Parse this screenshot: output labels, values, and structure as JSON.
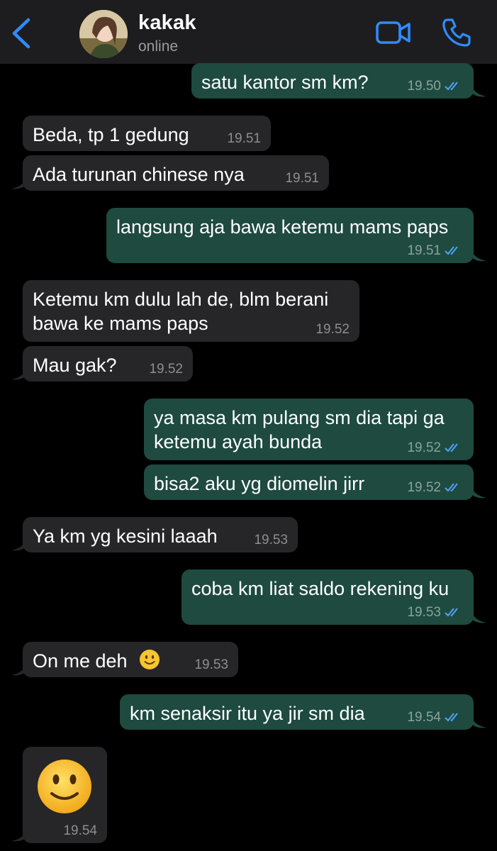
{
  "header": {
    "contact_name": "kakak",
    "status": "online",
    "back_icon": "chevron-left-icon",
    "video_icon": "video-camera-icon",
    "call_icon": "phone-icon",
    "accent": "#2f8cff"
  },
  "messages": [
    {
      "dir": "out",
      "text": "satu kantor sm km?",
      "time": "19.50"
    },
    {
      "dir": "in",
      "text": "Beda, tp 1 gedung",
      "time": "19.51"
    },
    {
      "dir": "in",
      "text": "Ada turunan chinese nya",
      "time": "19.51"
    },
    {
      "dir": "out",
      "text": "langsung aja bawa ketemu mams paps",
      "time": "19.51"
    },
    {
      "dir": "in",
      "text_line1": "Ketemu km dulu lah de, blm berani",
      "text_line2": "bawa ke mams paps",
      "time": "19.52"
    },
    {
      "dir": "in",
      "text": "Mau gak?",
      "time": "19.52"
    },
    {
      "dir": "out",
      "text_line1": "ya masa km pulang sm dia tapi ga",
      "text_line2": "ketemu ayah bunda",
      "time": "19.52"
    },
    {
      "dir": "out",
      "text": "bisa2 aku yg diomelin jirr",
      "time": "19.52"
    },
    {
      "dir": "in",
      "text": "Ya km yg kesini laaah",
      "time": "19.53"
    },
    {
      "dir": "out",
      "text": "coba km liat saldo rekening ku",
      "time": "19.53"
    },
    {
      "dir": "in",
      "text": "On me deh",
      "emoji": "slightly-smiling-face",
      "time": "19.53"
    },
    {
      "dir": "out",
      "text": "km senaksir itu ya jir sm dia",
      "time": "19.54"
    },
    {
      "dir": "in",
      "emoji": "slightly-smiling-face",
      "time": "19.54"
    }
  ],
  "colors": {
    "incoming_bubble": "#262628",
    "outgoing_bubble": "#1e4a3f",
    "read_ticks": "#4fa3f7"
  }
}
